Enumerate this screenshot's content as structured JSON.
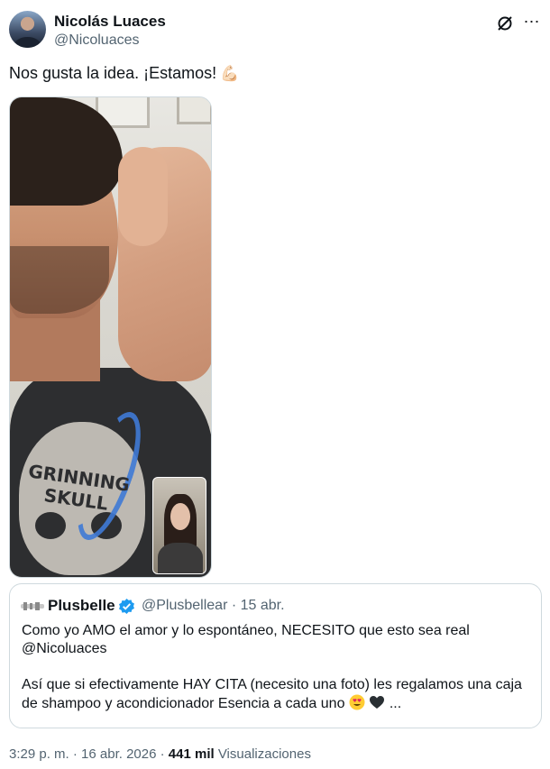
{
  "author": {
    "name": "Nicolás Luaces",
    "handle": "@Nicoluaces"
  },
  "tweet": {
    "text": "Nos gusta la idea. ¡Estamos!",
    "emoji": "💪🏻"
  },
  "quoted_tweet": {
    "name": "Plusbelle",
    "handle_date": "@Plusbellear · 15 abr.",
    "line1": "Como yo AMO el amor y lo espontáneo, NECESITO que esto sea real",
    "line2": "@Nicoluaces",
    "line3": "Así que si efectivamente HAY CITA (necesito una foto) les regalamos una caja",
    "line4_text": "de shampoo y acondicionador Esencia a cada uno",
    "line4_suffix": "...",
    "shirt_text": "GRINNING\nSKULL"
  },
  "meta": {
    "datetime": "3:29 p. m. · 16 abr. 2026 ·",
    "views_count": "441 mil",
    "views_label": "Visualizaciones"
  },
  "colors": {
    "text_primary": "#0f1419",
    "text_secondary": "#536471",
    "border": "#cfd9de",
    "verified": "#1d9bf0"
  },
  "icons": [
    "grok-icon",
    "more-icon",
    "verified-badge-icon",
    "heart-eyes-emoji",
    "black-heart-emoji",
    "flexed-biceps-emoji"
  ]
}
